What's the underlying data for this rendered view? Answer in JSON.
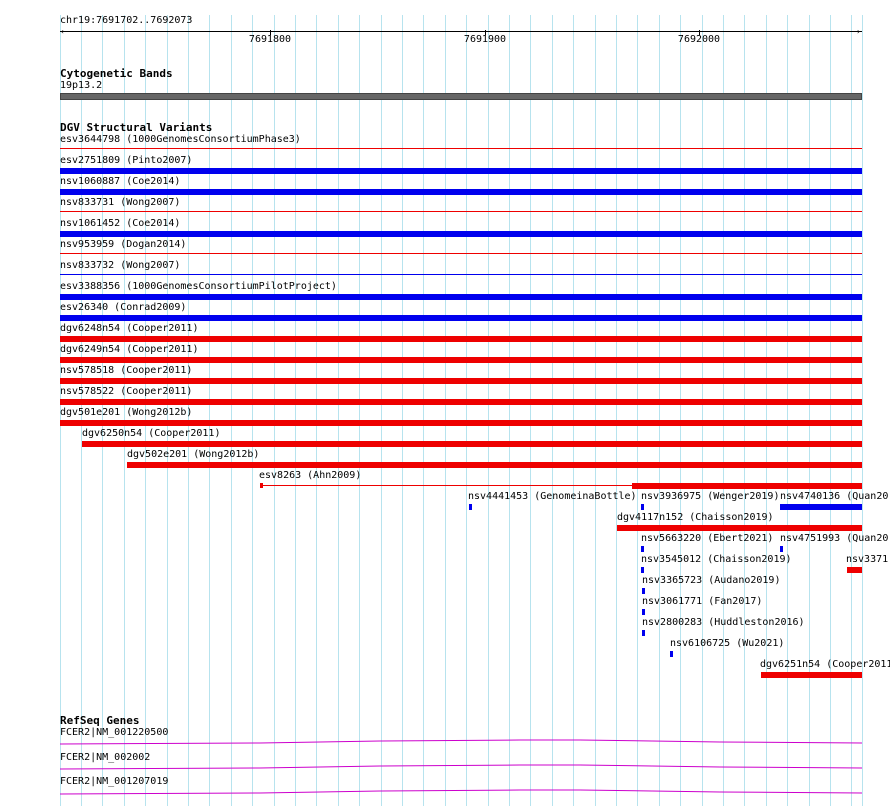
{
  "ruler": {
    "location": "chr19:7691702..7692073",
    "ticks": [
      "7691800",
      "7691900",
      "7692000"
    ]
  },
  "cytoband": {
    "title": "Cytogenetic Bands",
    "band": "19p13.2"
  },
  "dgv": {
    "title": "DGV Structural Variants",
    "variants": [
      "esv3644798 (1000GenomesConsortiumPhase3)",
      "esv2751809 (Pinto2007)",
      "nsv1060887 (Coe2014)",
      "nsv833731 (Wong2007)",
      "nsv1061452 (Coe2014)",
      "nsv953959 (Dogan2014)",
      "nsv833732 (Wong2007)",
      "esv3388356 (1000GenomesConsortiumPilotProject)",
      "esv26340 (Conrad2009)",
      "dgv6248n54 (Cooper2011)",
      "dgv6249n54 (Cooper2011)",
      "nsv578518 (Cooper2011)",
      "nsv578522 (Cooper2011)",
      "dgv501e201 (Wong2012b)",
      "dgv6250n54 (Cooper2011)",
      "dgv502e201 (Wong2012b)",
      "esv8263 (Ahn2009)",
      "nsv4441453 (GenomeinaBottle)",
      "nsv3936975 (Wenger2019)",
      "nsv4740136 (Quan20",
      "dgv4117n152 (Chaisson2019)",
      "nsv5663220 (Ebert2021)",
      "nsv4751993 (Quan20",
      "nsv3545012 (Chaisson2019)",
      "nsv3371",
      "nsv3365723 (Audano2019)",
      "nsv3061771 (Fan2017)",
      "nsv2800283 (Huddleston2016)",
      "nsv6106725 (Wu2021)",
      "dgv6251n54 (Cooper2011"
    ]
  },
  "refseq": {
    "title": "RefSeq Genes",
    "genes": [
      "FCER2|NM_001220500",
      "FCER2|NM_002002",
      "FCER2|NM_001207019"
    ]
  },
  "colors": {
    "gain": "#0000ee",
    "loss": "#ee0000",
    "gene": "#cc00cc",
    "grid": "#b7e3ee",
    "cytoband": "#666666"
  }
}
